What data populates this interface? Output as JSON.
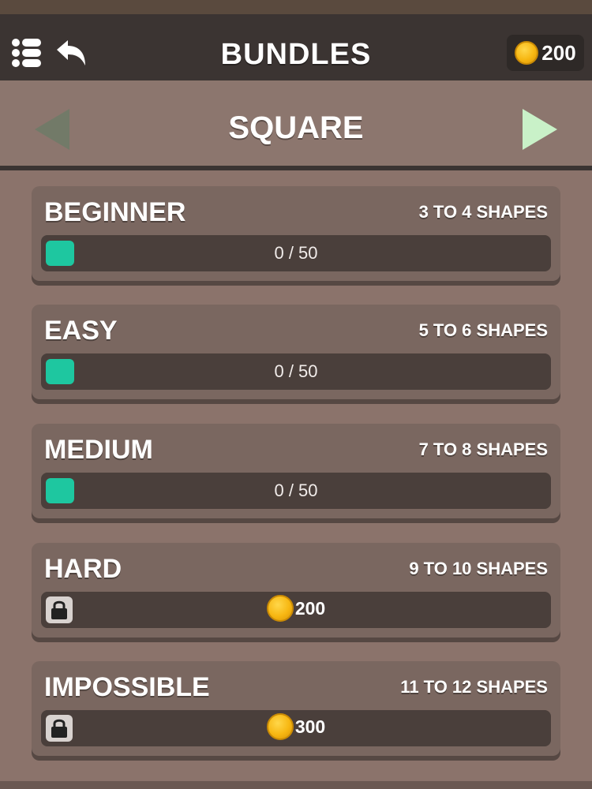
{
  "header": {
    "title": "BUNDLES",
    "coins": "200"
  },
  "pack": {
    "name": "SQUARE"
  },
  "colors": {
    "accent": "#1ec7a0",
    "coin": "#f7b712",
    "header_bg": "#3b3432"
  },
  "icons": {
    "menu": "menu-icon",
    "back": "back-arrow-icon",
    "prev": "triangle-left-icon",
    "next": "triangle-right-icon",
    "lock": "lock-icon",
    "coin": "coin-icon"
  },
  "bundles": [
    {
      "name": "BEGINNER",
      "shapes": "3 TO 4 SHAPES",
      "progress_text": "0 / 50",
      "progress": 0
    },
    {
      "name": "EASY",
      "shapes": "5 TO 6 SHAPES",
      "progress_text": "0 / 50",
      "progress": 0
    },
    {
      "name": "MEDIUM",
      "shapes": "7 TO 8 SHAPES",
      "progress_text": "0 / 50",
      "progress": 0
    },
    {
      "name": "HARD",
      "shapes": "9 TO 10 SHAPES",
      "locked": true,
      "price": "200"
    },
    {
      "name": "IMPOSSIBLE",
      "shapes": "11 TO 12 SHAPES",
      "locked": true,
      "price": "300"
    }
  ]
}
